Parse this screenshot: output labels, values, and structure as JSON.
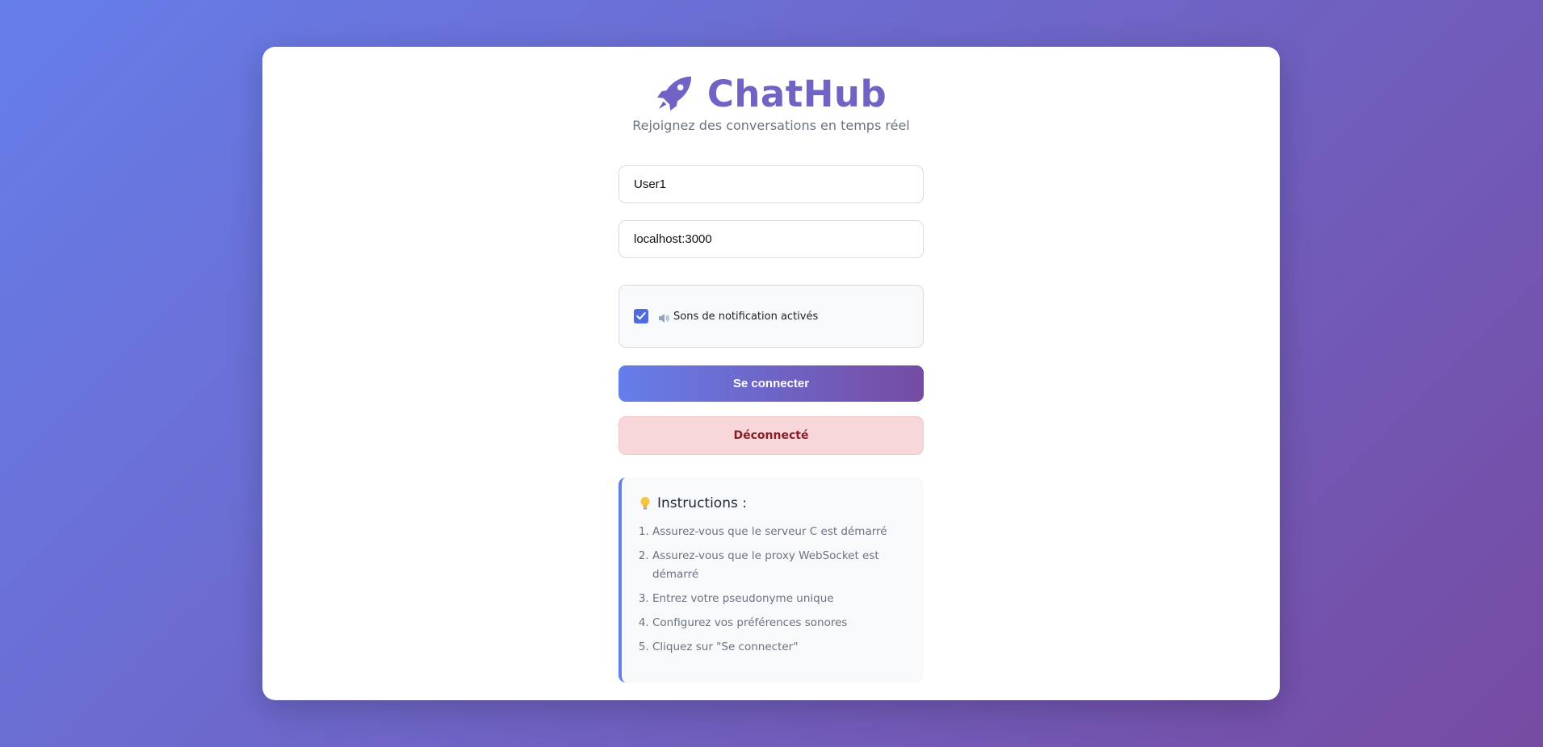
{
  "app": {
    "title": "ChatHub",
    "subtitle": "Rejoignez des conversations en temps réel",
    "icon": "rocket-icon"
  },
  "form": {
    "username_value": "User1",
    "server_value": "localhost:3000",
    "sound_checked": true,
    "sound_label": "Sons de notification activés",
    "connect_label": "Se connecter",
    "status_text": "Déconnecté"
  },
  "instructions": {
    "title": "Instructions :",
    "items": [
      "Assurez-vous que le serveur C est démarré",
      "Assurez-vous que le proxy WebSocket est démarré",
      "Entrez votre pseudonyme unique",
      "Configurez vos préférences sonores",
      "Cliquez sur \"Se connecter\""
    ]
  },
  "colors": {
    "accent": "#667eea",
    "accent_end": "#764ba2",
    "brand_text": "#6f63c4",
    "status_bg": "#f8d7da",
    "status_text": "#842029"
  }
}
